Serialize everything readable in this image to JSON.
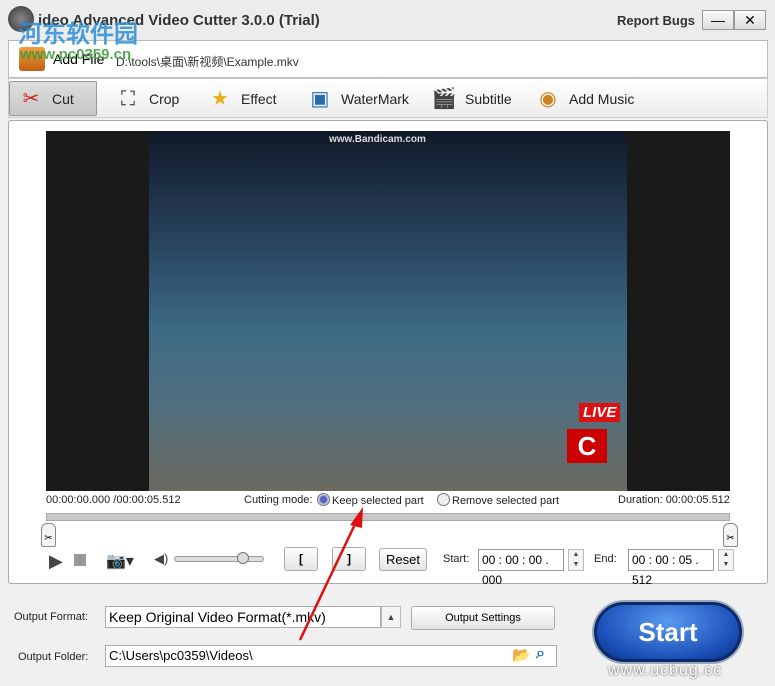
{
  "window": {
    "title": "Joboshare Video Advanced Video Cutter 3.0.0 (Trial)",
    "title_visible": "ideo Advanced Video Cutter 3.0.0 (Trial)",
    "report_bugs": "Report Bugs",
    "minimize": "—",
    "close": "✕"
  },
  "file": {
    "add_file": "Add File",
    "path": "D:\\tools\\桌面\\新视频\\Example.mkv"
  },
  "toolbar": [
    {
      "label": "Cut",
      "icon": "scissors-icon",
      "active": true
    },
    {
      "label": "Crop",
      "icon": "crop-icon"
    },
    {
      "label": "Effect",
      "icon": "star-icon"
    },
    {
      "label": "WaterMark",
      "icon": "watermark-icon"
    },
    {
      "label": "Subtitle",
      "icon": "subtitle-icon"
    },
    {
      "label": "Add Music",
      "icon": "music-icon"
    }
  ],
  "video": {
    "overlay": "www.Bandicam.com",
    "live": "LIVE",
    "channel": "C"
  },
  "info": {
    "position": "00:00:00.000 /00:00:05.512",
    "cutting_mode_label": "Cutting mode:",
    "keep": "Keep selected part",
    "remove": "Remove selected part",
    "mode": "keep",
    "duration": "Duration: 00:00:05.512"
  },
  "controls": {
    "volume": 0.75,
    "mark_in": "[",
    "mark_out": "]",
    "reset": "Reset",
    "start_label": "Start:",
    "start_value": "00 : 00 : 00 . 000",
    "end_label": "End:",
    "end_value": "00 : 00 : 05 . 512"
  },
  "output": {
    "format_label": "Output Format:",
    "format_value": "Keep Original Video Format(*.mkv)",
    "settings": "Output Settings",
    "folder_label": "Output Folder:",
    "folder_value": "C:\\Users\\pc0359\\Videos\\",
    "start": "Start"
  },
  "watermarks": {
    "site1": "河东软件园",
    "site1_url": "www.pc0359.cn",
    "site2": "www.ucbug.cc"
  },
  "colors": {
    "start_button": "#1a4fb8",
    "arrow": "#e01010"
  }
}
